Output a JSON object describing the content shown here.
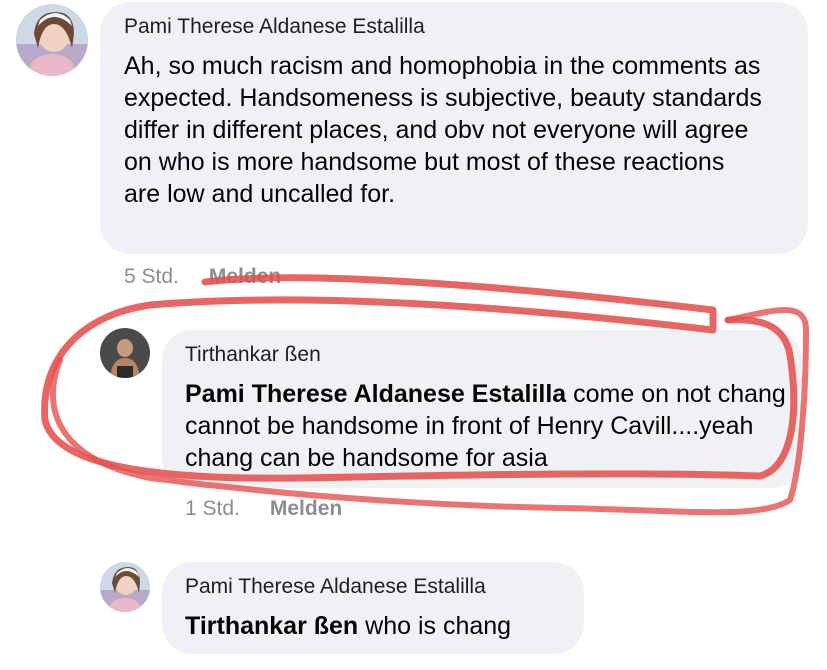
{
  "comments": [
    {
      "author": "Pami Therese Aldanese Estalilla",
      "mention": "",
      "text": "Ah, so much racism and homophobia in the comments as expected. Handsomeness is subjective, beauty standards differ in different places, and obv not everyone will agree on who is more handsome but most of these reactions are low and uncalled for.",
      "time": "5 Std.",
      "report": "Melden"
    },
    {
      "author": "Tirthankar ßen",
      "mention": "Pami Therese Aldanese Estalilla",
      "text": "come on not chang cannot be handsome in front of Henry Cavill....yeah chang can be handsome for asia",
      "time": "1 Std.",
      "report": "Melden"
    },
    {
      "author": "Pami Therese Aldanese Estalilla",
      "mention": "Tirthankar ßen",
      "text": "who is chang",
      "time": "",
      "report": ""
    }
  ],
  "colors": {
    "bubble": "#f0f1f4",
    "meta_text": "#8a8d91",
    "annotation_stroke": "#e4514f"
  }
}
